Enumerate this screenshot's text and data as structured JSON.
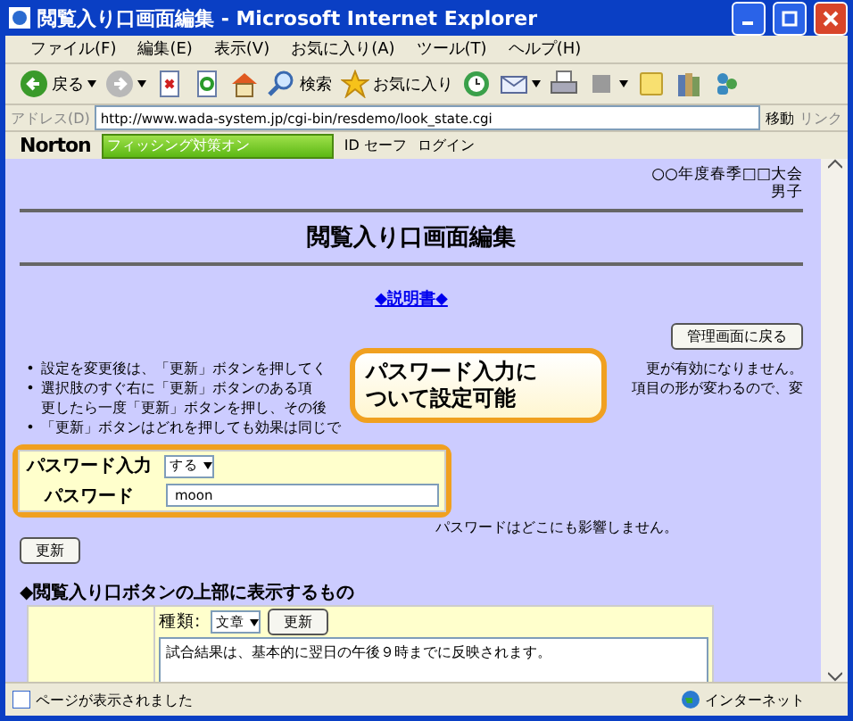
{
  "window": {
    "title": "閲覧入り口画面編集 - Microsoft Internet Explorer"
  },
  "menu": [
    "ファイル(F)",
    "編集(E)",
    "表示(V)",
    "お気に入り(A)",
    "ツール(T)",
    "ヘルプ(H)"
  ],
  "toolbar": [
    {
      "kind": "back",
      "label": "戻る",
      "dropdown": true
    },
    {
      "kind": "forward",
      "dropdown": true
    },
    {
      "kind": "stop"
    },
    {
      "kind": "refresh"
    },
    {
      "kind": "home"
    },
    {
      "kind": "search",
      "label": "検索"
    },
    {
      "kind": "favorites",
      "label": "お気に入り"
    },
    {
      "kind": "history"
    },
    {
      "kind": "mail",
      "dropdown": true
    },
    {
      "kind": "print"
    },
    {
      "kind": "edit",
      "dropdown": true
    },
    {
      "kind": "note"
    },
    {
      "kind": "books"
    },
    {
      "kind": "people"
    }
  ],
  "address_bar": {
    "label": "アドレス(D)",
    "value": "http://www.wada-system.jp/cgi-bin/resdemo/look_state.cgi",
    "go": "移動",
    "links": "リンク"
  },
  "norton": {
    "brand": "Norton",
    "phishing": "フィッシング対策オン",
    "id_safe": "ID セーフ",
    "login": "ログイン"
  },
  "page": {
    "header_lines": [
      "○○年度春季□□大会",
      "男子"
    ],
    "title": "閲覧入り口画面編集",
    "manual_link": "◆説明書◆",
    "back_button": "管理画面に戻る",
    "bullets": [
      {
        "marker": "•",
        "lines": [
          {
            "left": "設定を変更後は、「更新」ボタンを押してく",
            "right": "更が有効になりません。"
          }
        ]
      },
      {
        "marker": "•",
        "lines": [
          {
            "left": "選択肢のすぐ右に「更新」ボタンのある項",
            "right": "項目の形が変わるので、変"
          },
          {
            "left": "更したら一度「更新」ボタンを押し、その後"
          }
        ]
      },
      {
        "marker": "•",
        "lines": [
          {
            "left": "「更新」ボタンはどれを押しても効果は同じで"
          }
        ]
      }
    ],
    "form": [
      {
        "kind": "select",
        "label": "パスワード入力",
        "value": "する"
      },
      {
        "kind": "text",
        "label": "パスワード",
        "value": "moon"
      }
    ],
    "note": "パスワードはどこにも影響しません。",
    "update_button": "更新",
    "section": {
      "heading": "◆閲覧入り口ボタンの上部に表示するもの",
      "type_label": "種類:",
      "type_value": "文章",
      "update_button": "更新",
      "text": "試合結果は、基本的に翌日の午後９時までに反映されます。"
    }
  },
  "callout": {
    "lines": [
      "パスワード入力に",
      "ついて設定可能"
    ]
  },
  "status_bar": {
    "message": "ページが表示されました",
    "zone": "インターネット"
  }
}
